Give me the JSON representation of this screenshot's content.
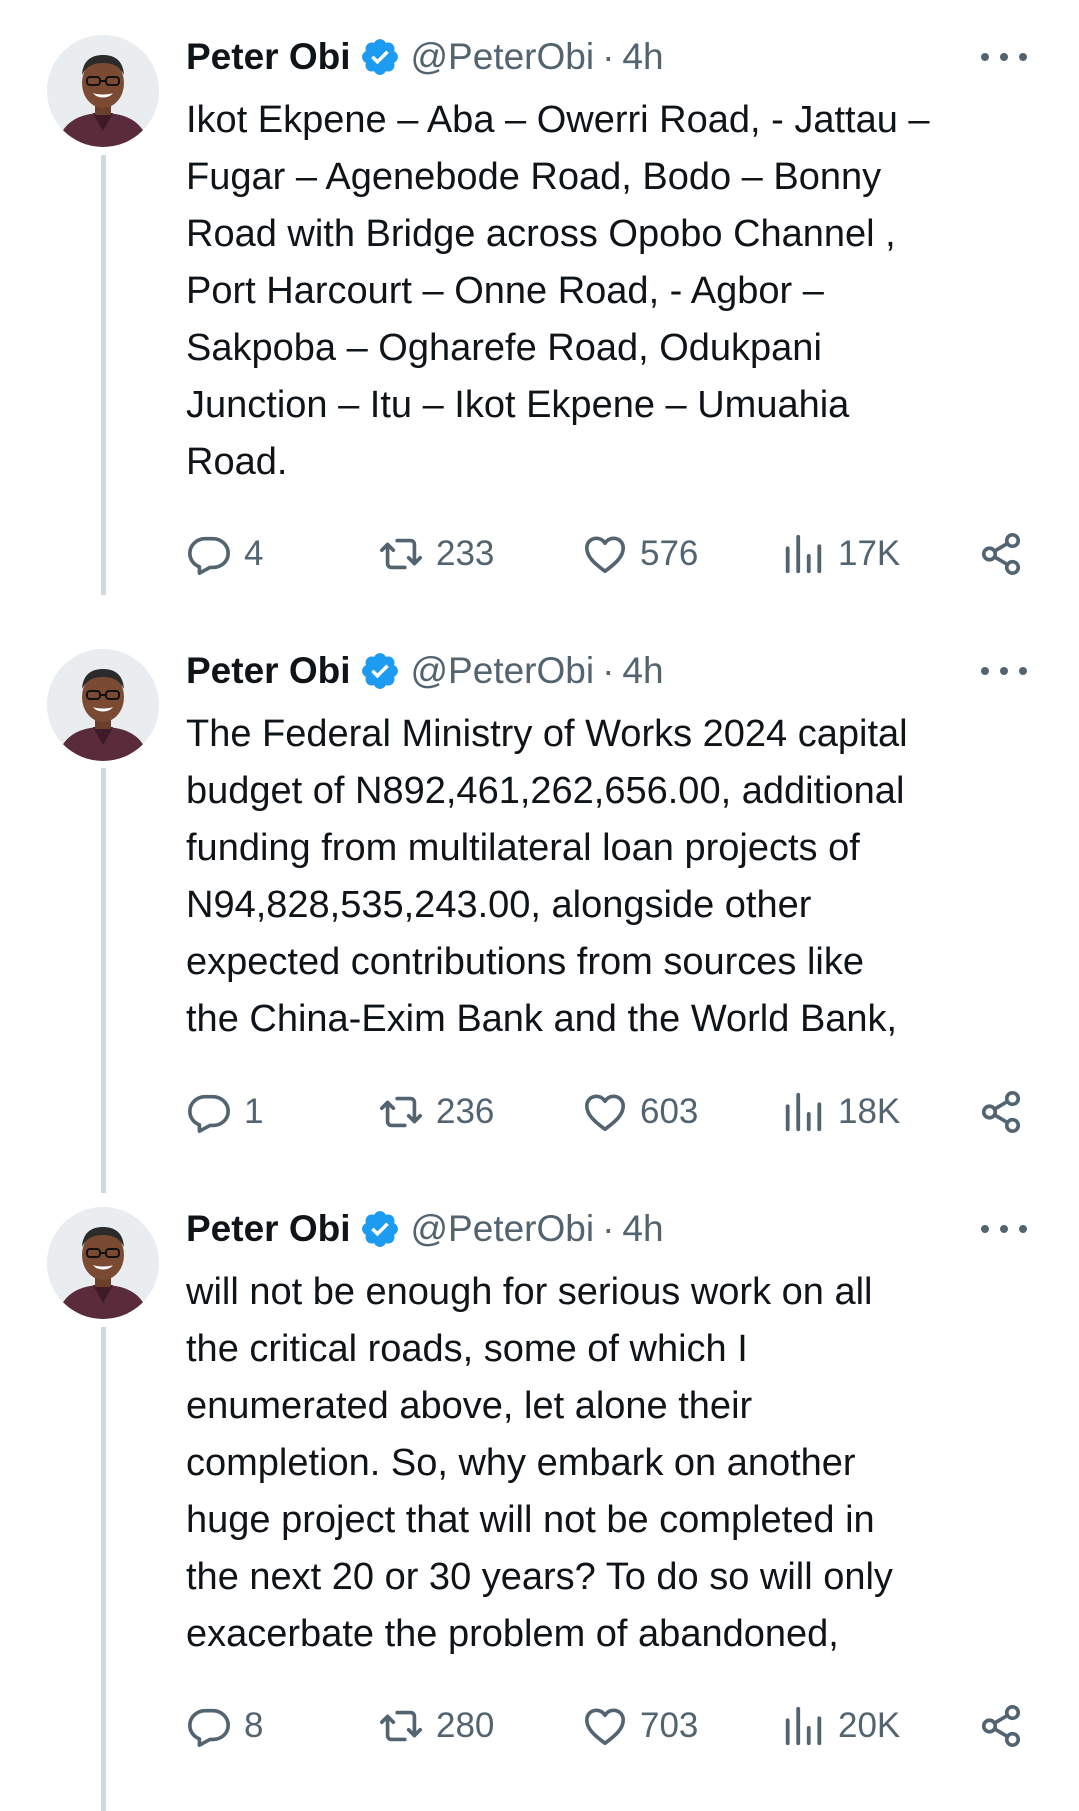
{
  "tweets": [
    {
      "name": "Peter Obi",
      "handle": "@PeterObi",
      "separator": "·",
      "time": "4h",
      "text": "Ikot Ekpene – Aba – Owerri Road, - Jattau –\nFugar – Agenebode Road, Bodo – Bonny\nRoad with Bridge across Opobo Channel ,\nPort Harcourt – Onne Road, - Agbor –\nSakpoba – Ogharefe Road, Odukpani\nJunction – Itu – Ikot Ekpene – Umuahia\nRoad.",
      "replies": "4",
      "retweets": "233",
      "likes": "576",
      "views": "17K"
    },
    {
      "name": "Peter Obi",
      "handle": "@PeterObi",
      "separator": "·",
      "time": "4h",
      "text": "The Federal Ministry of Works 2024 capital\nbudget of N892,461,262,656.00, additional\nfunding from multilateral loan projects of\nN94,828,535,243.00, alongside other\nexpected contributions from sources like\nthe China-Exim Bank and the World Bank,",
      "replies": "1",
      "retweets": "236",
      "likes": "603",
      "views": "18K"
    },
    {
      "name": "Peter Obi",
      "handle": "@PeterObi",
      "separator": "·",
      "time": "4h",
      "text": "will not be enough for serious work on all\nthe critical roads, some of which I\nenumerated above, let alone their\ncompletion. So, why embark on another\nhuge project that will not be completed in\nthe next 20 or 30 years? To do so will only\nexacerbate the problem of abandoned,",
      "replies": "8",
      "retweets": "280",
      "likes": "703",
      "views": "20K"
    }
  ],
  "colors": {
    "text": "#0f1419",
    "secondary": "#536471",
    "verified": "#1d9bf0",
    "thread_line": "#cfd9de"
  },
  "icons": [
    "verified-badge-icon",
    "more-icon",
    "reply-icon",
    "retweet-icon",
    "like-icon",
    "views-icon",
    "share-icon"
  ]
}
